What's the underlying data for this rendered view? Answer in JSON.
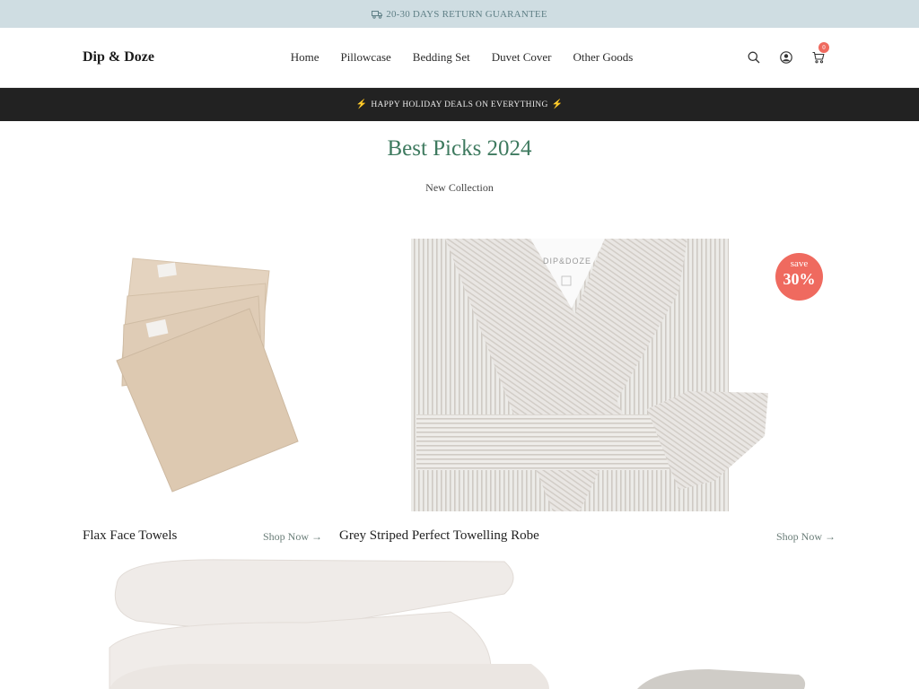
{
  "announcement": {
    "icon": "truck-icon",
    "text": "20-30 DAYS RETURN GUARANTEE"
  },
  "header": {
    "logo": "Dip & Doze",
    "nav": [
      {
        "label": "Home"
      },
      {
        "label": "Pillowcase"
      },
      {
        "label": "Bedding Set"
      },
      {
        "label": "Duvet Cover"
      },
      {
        "label": "Other Goods"
      }
    ],
    "icons": [
      "search-icon",
      "account-icon",
      "cart-icon"
    ],
    "cart_count": "0"
  },
  "promo": {
    "text": "HAPPY HOLIDAY DEALS ON EVERYTHING",
    "icon": "lightning-icon"
  },
  "section": {
    "title": "Best Picks 2024",
    "subtitle": "New Collection"
  },
  "products": [
    {
      "title": "Flax Face Towels",
      "cta": "Shop Now →"
    },
    {
      "title": "Grey Striped Perfect Towelling Robe",
      "cta": "Shop Now →",
      "badge": {
        "line1": "save",
        "line2": "30%"
      },
      "label": "DIP&DOZE"
    }
  ],
  "colors": {
    "announcement_bg": "#cfdde2",
    "promo_bg": "#222222",
    "title_green": "#3e7a5f",
    "badge_red": "#ef6a5f"
  }
}
